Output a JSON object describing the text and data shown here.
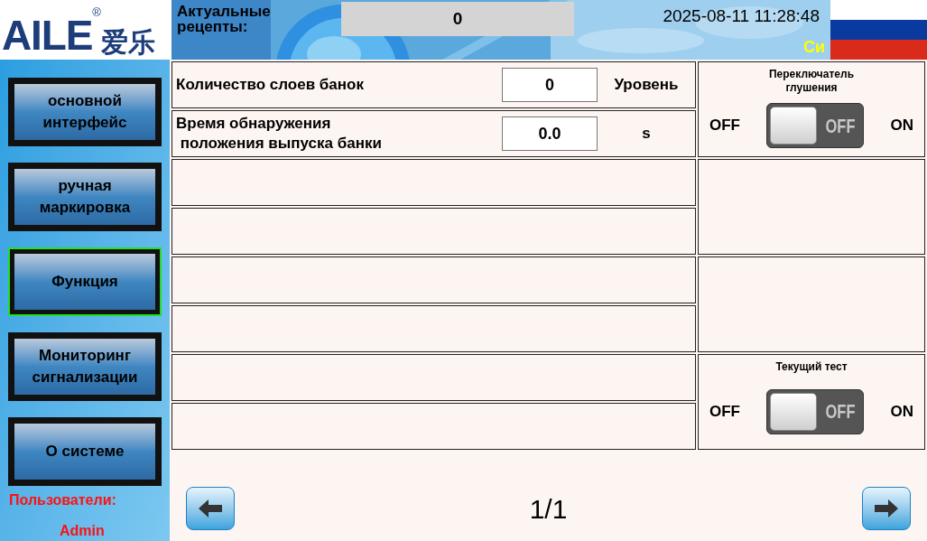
{
  "logo": {
    "text": "AILE",
    "mark": "®",
    "cjk": "爱乐"
  },
  "header": {
    "recipe_label": "Актуальные рецепты:",
    "recipe_value": "0",
    "datetime": "2025-08-11 11:28:48",
    "language": "Си"
  },
  "nav": [
    {
      "label": "основной интерфейс",
      "selected": false
    },
    {
      "label": "ручная маркировка",
      "selected": false
    },
    {
      "label": "Функция",
      "selected": true
    },
    {
      "label": "Мониторинг сигнализации",
      "selected": false
    },
    {
      "label": "О системе",
      "selected": false
    }
  ],
  "user": {
    "label": "Пользователи:",
    "name": "Admin"
  },
  "rows": [
    {
      "kind": "param",
      "label": "Количество слоев банок",
      "value": "0",
      "unit": "Уровень"
    },
    {
      "kind": "param",
      "label": "Время обнаружения\n положения выпуска банки",
      "value": "0.0",
      "unit": "s"
    },
    {
      "kind": "empty"
    },
    {
      "kind": "empty"
    },
    {
      "kind": "empty"
    },
    {
      "kind": "empty"
    },
    {
      "kind": "empty"
    },
    {
      "kind": "empty"
    }
  ],
  "panels": [
    {
      "kind": "toggle",
      "title": "Переключатель глушения",
      "off_label": "OFF",
      "on_label": "ON",
      "switch_text": "OFF",
      "on": false
    },
    {
      "kind": "empty"
    },
    {
      "kind": "empty"
    },
    {
      "kind": "toggle",
      "title": "Текущий тест",
      "off_label": "OFF",
      "on_label": "ON",
      "switch_text": "OFF",
      "on": false
    }
  ],
  "pager": {
    "text": "1/1"
  }
}
